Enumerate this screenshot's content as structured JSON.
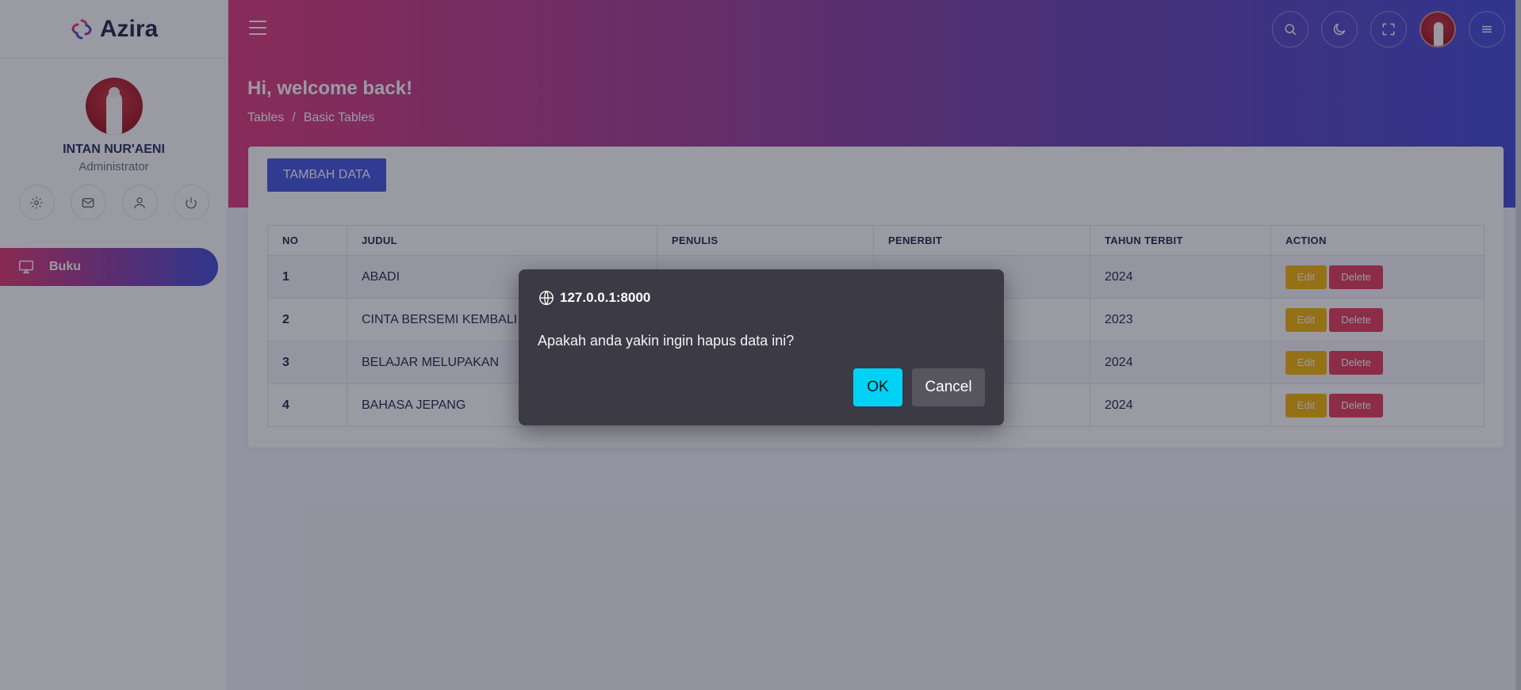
{
  "brand": {
    "name": "Azira"
  },
  "profile": {
    "name": "INTAN NUR'AENI",
    "role": "Administrator"
  },
  "sidebar": {
    "items": [
      {
        "label": "Buku",
        "icon": "monitor-icon"
      }
    ]
  },
  "header": {
    "welcome": "Hi, welcome back!"
  },
  "breadcrumb": {
    "items": [
      "Tables",
      "/",
      "Basic Tables"
    ]
  },
  "card": {
    "add_button": "TAMBAH DATA"
  },
  "table": {
    "columns": [
      "NO",
      "JUDUL",
      "PENULIS",
      "PENERBIT",
      "TAHUN TERBIT",
      "ACTION"
    ],
    "rows": [
      {
        "no": "1",
        "judul": "ABADI",
        "tahun": "2024"
      },
      {
        "no": "2",
        "judul": "CINTA BERSEMI KEMBALI",
        "tahun": "2023"
      },
      {
        "no": "3",
        "judul": "BELAJAR MELUPAKAN",
        "tahun": "2024"
      },
      {
        "no": "4",
        "judul": "BAHASA JEPANG",
        "tahun": "2024"
      }
    ],
    "edit_label": "Edit",
    "delete_label": "Delete"
  },
  "dialog": {
    "origin": "127.0.0.1:8000",
    "message": "Apakah anda yakin ingin hapus data ini?",
    "ok_label": "OK",
    "cancel_label": "Cancel"
  },
  "colors": {
    "accent_start": "#e0367a",
    "accent_end": "#3f48d8",
    "primary_button": "#4152e0",
    "edit_button": "#f5b400",
    "delete_button": "#e63a5a",
    "dialog_ok": "#00d2f5"
  }
}
